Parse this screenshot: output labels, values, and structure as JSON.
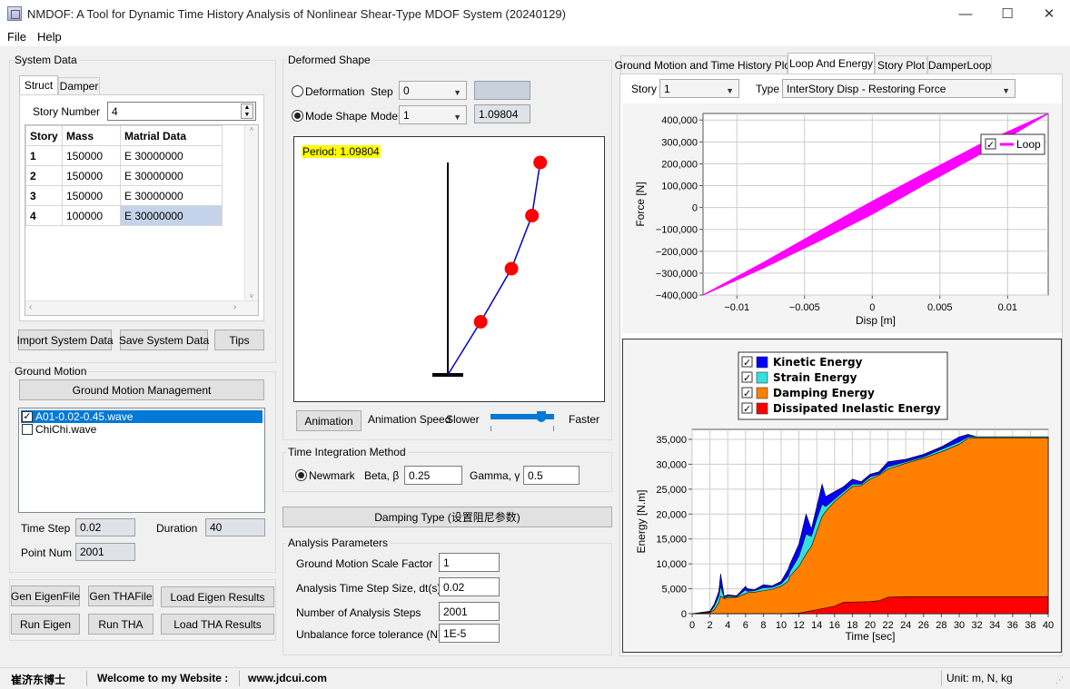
{
  "window": {
    "title": "NMDOF: A Tool for Dynamic Time History Analysis of Nonlinear Shear-Type MDOF System (20240129)",
    "minimize": "—",
    "maximize": "☐",
    "close": "✕"
  },
  "menu": [
    "File",
    "Help"
  ],
  "system_data": {
    "label": "System Data",
    "tabs": [
      "Struct",
      "Damper"
    ],
    "story_number_label": "Story Number",
    "story_number_value": "4",
    "table": {
      "headers": [
        "Story",
        "Mass",
        "Matrial Data"
      ],
      "rows": [
        [
          "1",
          "150000",
          "E 30000000"
        ],
        [
          "2",
          "150000",
          "E 30000000"
        ],
        [
          "3",
          "150000",
          "E 30000000"
        ],
        [
          "4",
          "100000",
          "E 30000000"
        ]
      ]
    },
    "buttons": [
      "Import System Data",
      "Save System Data",
      "Tips"
    ]
  },
  "ground_motion": {
    "label": "Ground Motion",
    "manage_button": "Ground Motion Management",
    "items": [
      "A01-0.02-0.45.wave",
      "ChiChi.wave"
    ],
    "time_step_label": "Time Step",
    "time_step_value": "0.02",
    "duration_label": "Duration",
    "duration_value": "40",
    "point_num_label": "Point Num",
    "point_num_value": "2001"
  },
  "actions": [
    "Gen EigenFile",
    "Gen THAFile",
    "Load Eigen Results",
    "Run Eigen",
    "Run THA",
    "Load THA Results"
  ],
  "deformed_shape": {
    "label": "Deformed Shape",
    "deformation_label": "Deformation",
    "step_label": "Step",
    "step_value": "0",
    "mode_shape_label": "Mode Shape",
    "mode_label": "Mode",
    "mode_value": "1",
    "period_value": "1.09804",
    "period_text": "Period: 1.09804",
    "animation_button": "Animation",
    "animation_speed_label": "Animation Speed",
    "slower_label": "Slower",
    "faster_label": "Faster",
    "slider_level": 0.8,
    "mode_points": [
      [
        0,
        0
      ],
      [
        0.32,
        1
      ],
      [
        0.62,
        2
      ],
      [
        0.82,
        3
      ],
      [
        0.9,
        4
      ]
    ]
  },
  "time_integration": {
    "label": "Time Integration Method",
    "newmark_label": "Newmark",
    "beta_label": "Beta, β",
    "beta_value": "0.25",
    "gamma_label": "Gamma, γ",
    "gamma_value": "0.5"
  },
  "damping_button": "Damping Type (设置阻尼参数)",
  "analysis_params": {
    "label": "Analysis Parameters",
    "rows": [
      {
        "label": "Ground Motion Scale Factor",
        "value": "1"
      },
      {
        "label": "Analysis Time Step Size, dt(s)",
        "value": "0.02"
      },
      {
        "label": "Number of Analysis Steps",
        "value": "2001"
      },
      {
        "label": "Unbalance force tolerance (N)",
        "value": "1E-5"
      }
    ]
  },
  "right_tabs": [
    "Ground Motion and Time History Plot",
    "Loop And Energy",
    "Story Plot",
    "DamperLoop"
  ],
  "loop": {
    "story_label": "Story",
    "story_value": "1",
    "type_label": "Type",
    "type_value": "InterStory Disp - Restoring Force"
  },
  "colors": {
    "loop": "#ff00ff",
    "kinetic": "#0000ff",
    "strain": "#33e0e0",
    "damping": "#ff8000",
    "inelastic": "#ff0000",
    "mode_line": "#0000cc",
    "mode_node": "#ff0000",
    "period_bg": "#ffff00"
  },
  "chart_data": [
    {
      "type": "line",
      "xlabel": "Disp [m]",
      "ylabel": "Force [N]",
      "xlim": [
        -0.0125,
        0.013
      ],
      "ylim": [
        -400000,
        430000
      ],
      "xticks": [
        -0.01,
        -0.005,
        0,
        0.005,
        0.01
      ],
      "xtick_labels": [
        "−0.01",
        "−0.005",
        "0",
        "0.005",
        "0.01"
      ],
      "yticks": [
        -400000,
        -300000,
        -200000,
        -100000,
        0,
        100000,
        200000,
        300000,
        400000
      ],
      "ytick_labels": [
        "−400,000",
        "−300,000",
        "−200,000",
        "−100,000",
        "0",
        "100,000",
        "200,000",
        "300,000",
        "400,000"
      ],
      "grid": true,
      "legend_position": "top-right",
      "series": [
        {
          "name": "Loop",
          "upper_branch": [
            [
              -0.0125,
              -400000
            ],
            [
              -0.008,
              -250000
            ],
            [
              -0.004,
              -110000
            ],
            [
              0,
              28000
            ],
            [
              0.004,
              160000
            ],
            [
              0.008,
              290000
            ],
            [
              0.013,
              430000
            ]
          ],
          "lower_branch": [
            [
              -0.0125,
              -400000
            ],
            [
              -0.008,
              -275000
            ],
            [
              -0.004,
              -155000
            ],
            [
              0,
              -30000
            ],
            [
              0.004,
              110000
            ],
            [
              0.008,
              245000
            ],
            [
              0.013,
              430000
            ]
          ]
        }
      ]
    },
    {
      "type": "area",
      "xlabel": "Time [sec]",
      "ylabel": "Energy [N.m]",
      "xlim": [
        0,
        40
      ],
      "ylim": [
        0,
        37000
      ],
      "xticks": [
        0,
        2,
        4,
        6,
        8,
        10,
        12,
        14,
        16,
        18,
        20,
        22,
        24,
        26,
        28,
        30,
        32,
        34,
        36,
        38,
        40
      ],
      "xtick_labels": [
        "0",
        "2",
        "4",
        "6",
        "8",
        "10",
        "12",
        "14",
        "16",
        "18",
        "20",
        "22",
        "24",
        "26",
        "28",
        "30",
        "32",
        "34",
        "36",
        "38",
        "40"
      ],
      "yticks": [
        0,
        5000,
        10000,
        15000,
        20000,
        25000,
        30000,
        35000
      ],
      "ytick_labels": [
        "0",
        "5,000",
        "10,000",
        "15,000",
        "20,000",
        "25,000",
        "30,000",
        "35,000"
      ],
      "grid": true,
      "legend_position": "top",
      "series": [
        {
          "name": "Kinetic Energy",
          "color": "#0000ff",
          "x": [
            0,
            2,
            2.5,
            3,
            3.2,
            3.6,
            4,
            5,
            6,
            6.2,
            7,
            8,
            9,
            10,
            10.8,
            11,
            12,
            12.8,
            13.4,
            14,
            14.6,
            15,
            16,
            17,
            18,
            19,
            20,
            21,
            22,
            24,
            26,
            28,
            30,
            31,
            32,
            34,
            36,
            38,
            40
          ],
          "values": [
            0,
            500,
            2000,
            4500,
            8000,
            3500,
            3800,
            3600,
            5500,
            5000,
            4800,
            5800,
            5600,
            6500,
            9000,
            10000,
            14000,
            20000,
            17000,
            21500,
            26000,
            23500,
            24500,
            25500,
            27000,
            26500,
            28000,
            28500,
            30500,
            31000,
            32000,
            33500,
            35500,
            36000,
            35500,
            35500,
            35500,
            35500,
            35500
          ]
        },
        {
          "name": "Strain Energy",
          "color": "#33e0e0",
          "x": [
            0,
            2,
            2.5,
            3,
            3.2,
            3.6,
            4,
            5,
            6,
            6.2,
            7,
            8,
            9,
            10,
            10.8,
            11,
            12,
            12.8,
            13.4,
            14,
            14.6,
            15,
            16,
            17,
            18,
            19,
            20,
            21,
            22,
            24,
            26,
            28,
            30,
            31,
            32,
            34,
            36,
            38,
            40
          ],
          "values": [
            0,
            300,
            1500,
            3500,
            5500,
            3200,
            3500,
            3400,
            4800,
            4500,
            4600,
            5200,
            5300,
            6000,
            7500,
            8500,
            11500,
            16000,
            15500,
            19000,
            22000,
            21500,
            23000,
            24500,
            26000,
            26000,
            27500,
            28000,
            29500,
            30500,
            31500,
            33000,
            34500,
            35500,
            35500,
            35500,
            35500,
            35500,
            35500
          ]
        },
        {
          "name": "Damping Energy",
          "color": "#ff8000",
          "x": [
            0,
            2,
            2.5,
            3,
            3.2,
            3.6,
            4,
            5,
            6,
            6.2,
            7,
            8,
            9,
            10,
            10.8,
            11,
            12,
            12.8,
            13.4,
            14,
            14.6,
            15,
            16,
            17,
            18,
            19,
            20,
            21,
            22,
            24,
            26,
            28,
            30,
            31,
            32,
            34,
            36,
            38,
            40
          ],
          "values": [
            0,
            200,
            800,
            2200,
            3500,
            3000,
            3200,
            3300,
            4000,
            4200,
            4300,
            4600,
            4900,
            5500,
            6500,
            7500,
            9500,
            12000,
            13500,
            16500,
            19500,
            20500,
            22500,
            24000,
            25500,
            25700,
            27000,
            27800,
            29000,
            30200,
            31200,
            32500,
            34000,
            35200,
            35300,
            35300,
            35300,
            35300,
            35300
          ]
        },
        {
          "name": "Dissipated Inelastic Energy",
          "color": "#ff0000",
          "x": [
            0,
            10,
            12,
            14,
            16,
            17,
            20,
            21,
            22,
            24,
            28,
            32,
            36,
            40
          ],
          "values": [
            0,
            0,
            100,
            800,
            1500,
            2300,
            2400,
            2600,
            3300,
            3400,
            3400,
            3400,
            3400,
            3400
          ]
        }
      ]
    }
  ],
  "status": {
    "author": "崔济东博士",
    "welcome": "Welcome to my Website :",
    "website": "www.jdcui.com",
    "unit": "Unit: m, N, kg"
  }
}
